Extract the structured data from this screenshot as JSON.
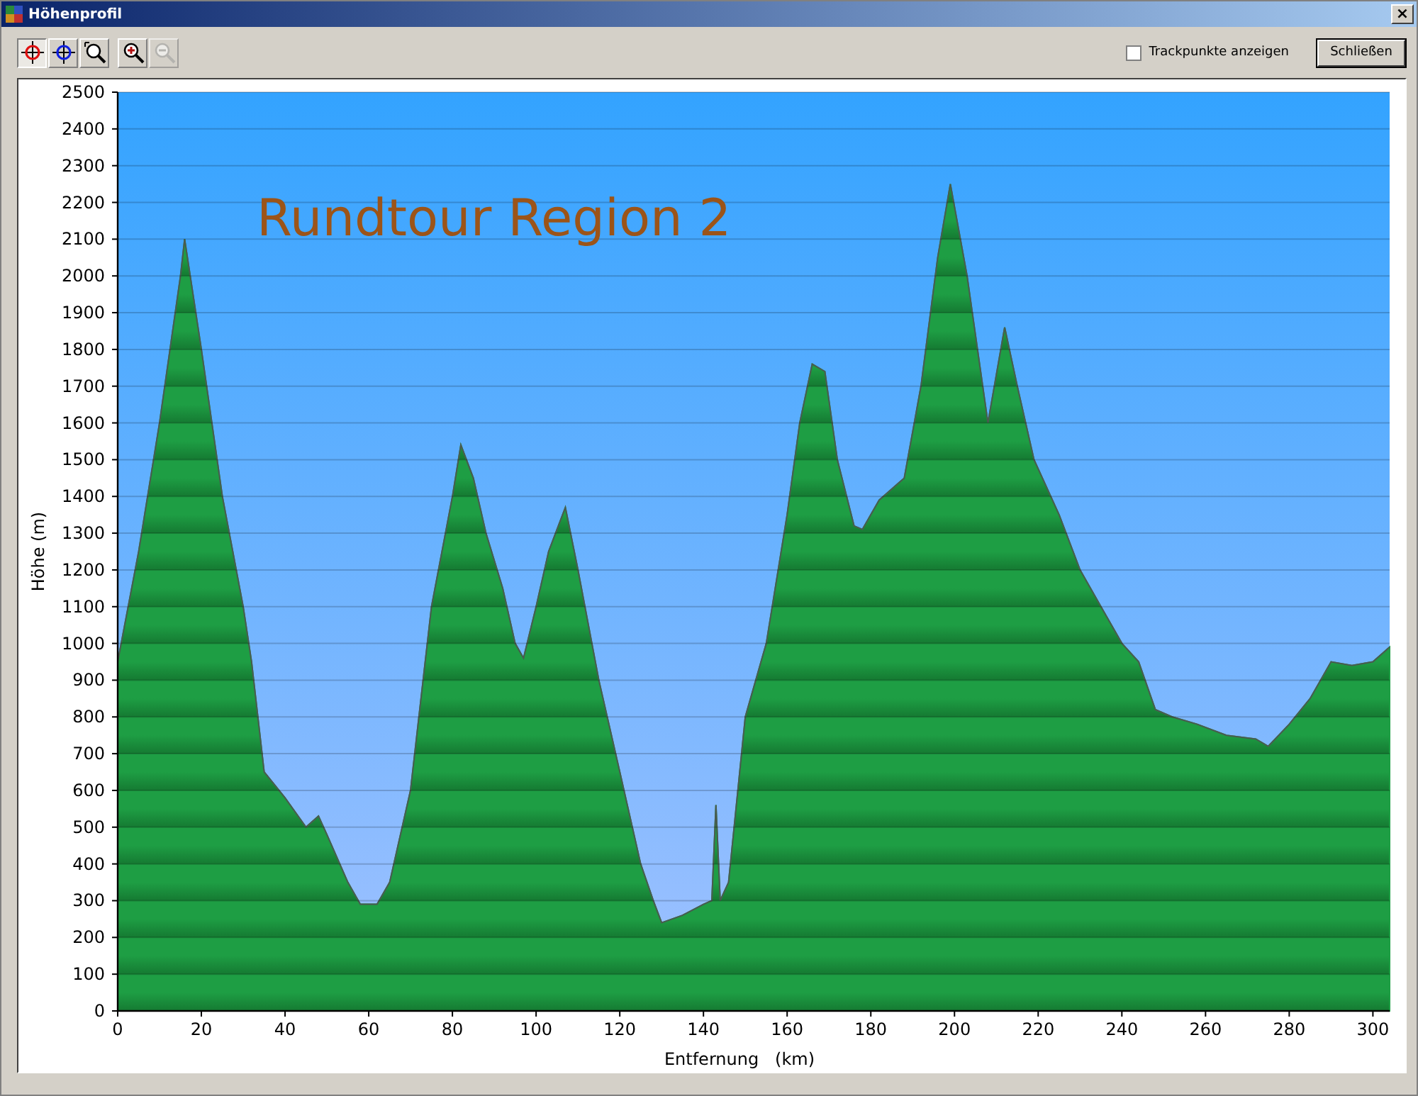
{
  "window": {
    "title": "Höhenprofil",
    "close_label": "×"
  },
  "toolbar": {
    "tools": [
      {
        "kind": "crosshair-red",
        "selected": true,
        "disabled": false
      },
      {
        "kind": "crosshair-blue",
        "selected": false,
        "disabled": false
      },
      {
        "kind": "zoom-select",
        "selected": false,
        "disabled": false
      },
      {
        "kind": "zoom-in",
        "selected": false,
        "disabled": false
      },
      {
        "kind": "zoom-out",
        "selected": false,
        "disabled": true
      }
    ],
    "trackpoints": {
      "label": "Trackpunkte anzeigen",
      "checked": false
    },
    "close_button": "Schließen"
  },
  "chart_data": {
    "type": "area",
    "xlabel": "Entfernung   (km)",
    "ylabel": "Höhe (m)",
    "xlim": [
      0,
      304
    ],
    "ylim": [
      0,
      2500
    ],
    "xticks": [
      0,
      20,
      40,
      60,
      80,
      100,
      120,
      140,
      160,
      180,
      200,
      220,
      240,
      260,
      280,
      300
    ],
    "yticks": [
      0,
      100,
      200,
      300,
      400,
      500,
      600,
      700,
      800,
      900,
      1000,
      1100,
      1200,
      1300,
      1400,
      1500,
      1600,
      1700,
      1800,
      1900,
      2000,
      2100,
      2200,
      2300,
      2400,
      2500
    ],
    "title": "Rundtour Region 2",
    "grid": true,
    "x": [
      0,
      5,
      10,
      15,
      16,
      20,
      25,
      30,
      32,
      35,
      40,
      45,
      48,
      50,
      55,
      58,
      62,
      65,
      70,
      75,
      80,
      82,
      85,
      88,
      92,
      95,
      97,
      100,
      103,
      107,
      110,
      115,
      120,
      125,
      128,
      130,
      135,
      140,
      142,
      143,
      144,
      146,
      150,
      155,
      160,
      163,
      166,
      169,
      172,
      176,
      178,
      182,
      188,
      192,
      196,
      199,
      203,
      208,
      212,
      215,
      219,
      225,
      230,
      235,
      240,
      244,
      248,
      252,
      258,
      265,
      272,
      275,
      280,
      285,
      290,
      295,
      300,
      304
    ],
    "values": [
      950,
      1250,
      1600,
      2000,
      2100,
      1800,
      1400,
      1100,
      950,
      650,
      580,
      500,
      530,
      480,
      350,
      290,
      290,
      350,
      600,
      1100,
      1400,
      1540,
      1450,
      1300,
      1150,
      1000,
      960,
      1100,
      1250,
      1370,
      1200,
      900,
      650,
      400,
      300,
      240,
      260,
      290,
      300,
      560,
      300,
      350,
      800,
      1000,
      1350,
      1600,
      1760,
      1740,
      1500,
      1320,
      1310,
      1390,
      1450,
      1700,
      2050,
      2250,
      2000,
      1600,
      1860,
      1700,
      1500,
      1350,
      1200,
      1100,
      1000,
      950,
      820,
      800,
      780,
      750,
      740,
      720,
      780,
      850,
      950,
      940,
      950,
      990
    ]
  }
}
